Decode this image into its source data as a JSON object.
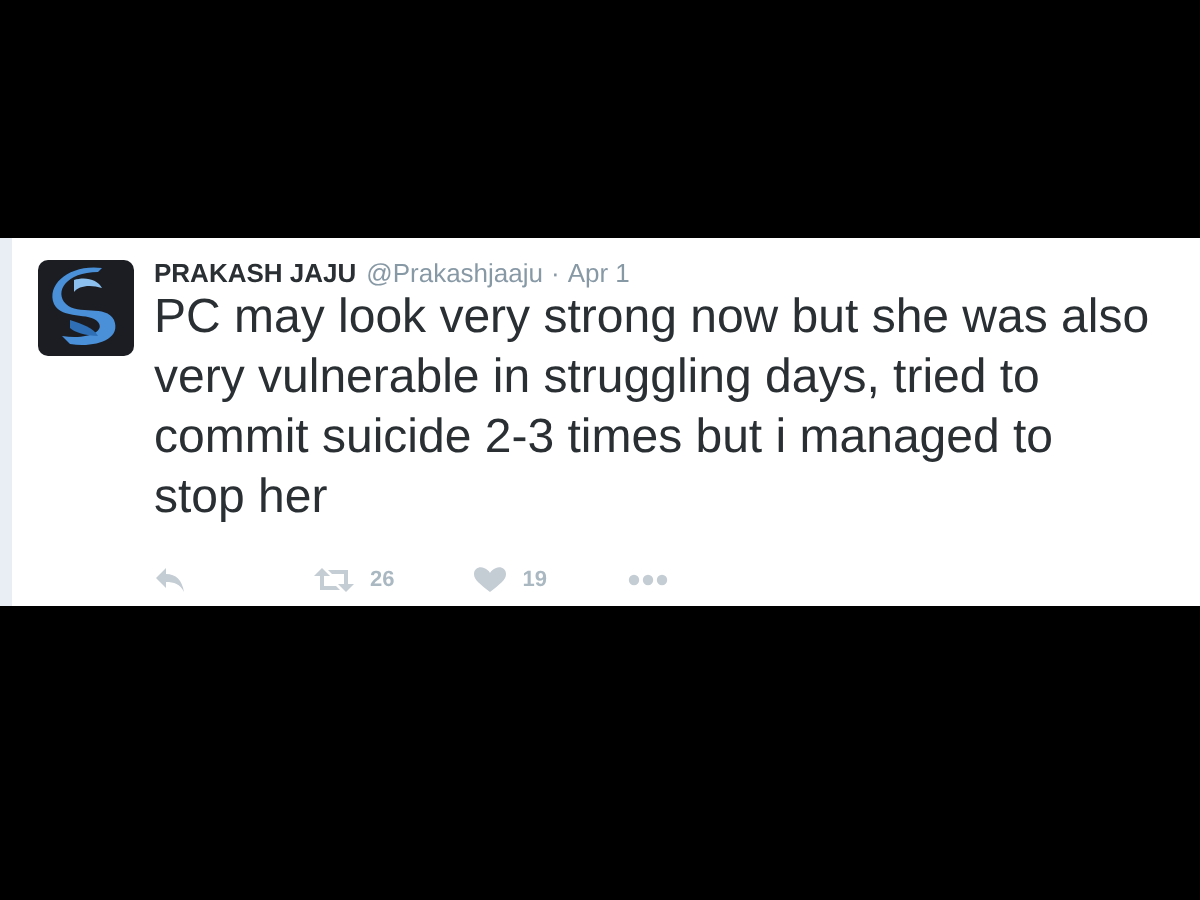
{
  "tweet": {
    "author_name": "PRAKASH JAJU",
    "handle": "@Prakashjaaju",
    "separator": "·",
    "date": "Apr 1",
    "text": "PC may look very strong now but she was also very vulnerable in struggling days, tried to commit suicide 2-3 times but i managed to stop her",
    "retweets": "26",
    "likes": "19"
  }
}
